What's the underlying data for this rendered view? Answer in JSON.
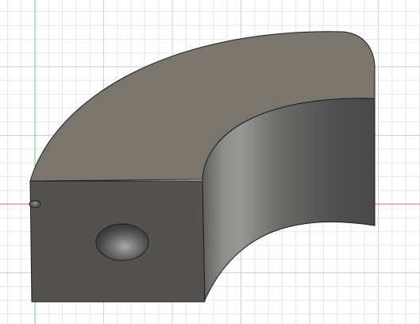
{
  "viewport": {
    "background": "#ffffff",
    "grid": {
      "visible": true,
      "minor_color": "#e7e7e7",
      "major_color": "#cfcfcf"
    },
    "axes": {
      "x_axis_color": "#e06a6a",
      "y_axis_color": "#5fd36f",
      "origin_icon": "origin-point-icon"
    }
  },
  "model": {
    "name": "curved-block",
    "type": "quarter-ring-block",
    "colors": {
      "top": "#7b766d",
      "side": "#54524e",
      "inner_light": "#8b8b88",
      "inner_dark": "#4d4d4c",
      "hole_rim": "#3d3d3d",
      "hole_fill_center": "#a6a6a6",
      "edge": "#1f1f1f"
    },
    "features": [
      "cylindrical-hole"
    ]
  }
}
